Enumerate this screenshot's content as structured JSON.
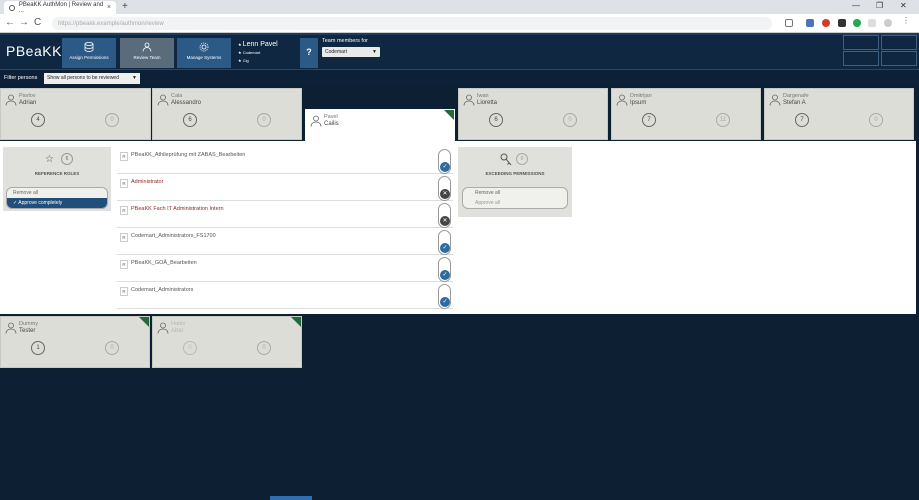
{
  "browser": {
    "tab_title": "PBeaKK AuthMon | Review and ...",
    "tab_close": "×",
    "new_tab": "+",
    "url": "https://pbeakk.example/authmon/review",
    "minimize": "—",
    "restore": "❐",
    "close": "✕",
    "back": "←",
    "forward": "→",
    "reload": "C"
  },
  "header": {
    "logo": "PBeaKK",
    "nav": [
      {
        "label": "Assign Permissions",
        "icon": "database-icon"
      },
      {
        "label": "Review Team",
        "icon": "person-icon"
      },
      {
        "label": "Manage Systems",
        "icon": "gear-icon"
      }
    ],
    "user": {
      "name": "Lenn Pavel",
      "line1": "Codemart",
      "line2": "Cig"
    },
    "help": "?",
    "team_label": "Team members for",
    "team_value": "Codemart",
    "caret": "▼"
  },
  "filter": {
    "label": "Filter persons",
    "value": "Show all persons to be reviewed",
    "caret": "▼"
  },
  "persons_top": [
    {
      "first": "Pavlov",
      "last": "Adrian",
      "c1": "4",
      "c2": "0",
      "selected": false,
      "corner": false
    },
    {
      "first": "Cala",
      "last": "Alessandro",
      "c1": "6",
      "c2": "0",
      "selected": false,
      "corner": false
    },
    {
      "first": "Pavel",
      "last": "Cailis",
      "c1": "",
      "c2": "",
      "selected": true,
      "corner": true
    },
    {
      "first": "Iwan",
      "last": "Lioretta",
      "c1": "6",
      "c2": "0",
      "selected": false,
      "corner": false
    },
    {
      "first": "Dmitrijan",
      "last": "Ipsum",
      "c1": "7",
      "c2": "11",
      "selected": false,
      "corner": false
    },
    {
      "first": "Dargenafe",
      "last": "Stefan A",
      "c1": "7",
      "c2": "0",
      "selected": false,
      "corner": false
    }
  ],
  "persons_bottom": [
    {
      "first": "Dummy",
      "last": "Tester",
      "c1": "1",
      "c2": "0",
      "corner": true,
      "faded": false
    },
    {
      "first": "Hattie",
      "last": "Abel",
      "c1": "0",
      "c2": "0",
      "corner": true,
      "faded": true
    }
  ],
  "reference": {
    "star": "☆",
    "count": "6",
    "title": "REFERENCE ROLES",
    "remove_all": "Remove all",
    "approve": "✓ Approve completely"
  },
  "roles": [
    {
      "tag": "R",
      "name": "PBeaKK_Athileprüfung mit ZABAS_Bearbeiten",
      "status": "ok",
      "red": false
    },
    {
      "tag": "R",
      "name": "Administrator",
      "status": "no",
      "red": true
    },
    {
      "tag": "R",
      "name": "PBeaKK Fach IT Administration Intern",
      "status": "no",
      "red": true
    },
    {
      "tag": "R",
      "name": "Codemart_Administrators_FS1700",
      "status": "ok",
      "red": false
    },
    {
      "tag": "R",
      "name": "PBeaKK_GOÄ_Bearbeiten",
      "status": "ok",
      "red": false
    },
    {
      "tag": "R",
      "name": "Codemart_Administrators",
      "status": "ok",
      "red": false
    }
  ],
  "status_glyphs": {
    "ok": "✓",
    "no": "✕"
  },
  "excess": {
    "count": "0",
    "title": "EXCEEDING PERMISSIONS",
    "remove_all": "Remove all",
    "approve": "Approve all"
  }
}
